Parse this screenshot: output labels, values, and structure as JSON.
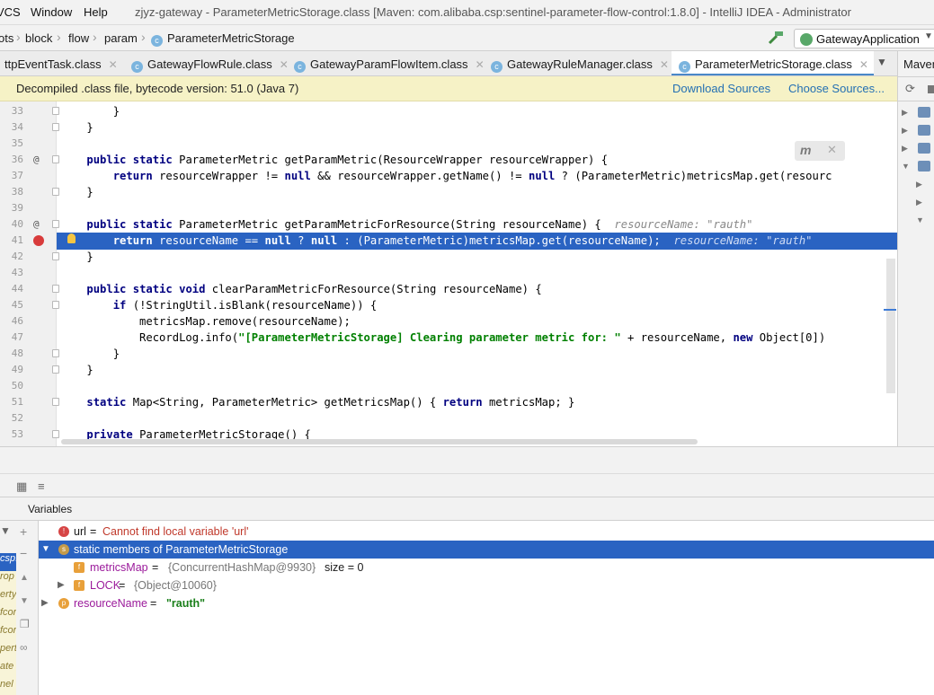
{
  "titlebar": {
    "menu": [
      "VCS",
      "Window",
      "Help"
    ],
    "title": "zjyz-gateway - ParameterMetricStorage.class [Maven: com.alibaba.csp:sentinel-parameter-flow-control:1.8.0] - IntelliJ IDEA - Administrator"
  },
  "nav": {
    "crumbs": [
      "ots",
      "block",
      "flow",
      "param",
      "ParameterMetricStorage"
    ],
    "run_config": "GatewayApplication"
  },
  "tabs": [
    {
      "label": "ttpEventTask.class",
      "active": false
    },
    {
      "label": "GatewayFlowRule.class",
      "active": false
    },
    {
      "label": "GatewayParamFlowItem.class",
      "active": false
    },
    {
      "label": "GatewayRuleManager.class",
      "active": false
    },
    {
      "label": "ParameterMetricStorage.class",
      "active": true
    }
  ],
  "maven": {
    "title": "Maven"
  },
  "banner": {
    "text": "Decompiled .class file, bytecode version: 51.0 (Java 7)",
    "download": "Download Sources",
    "choose": "Choose Sources..."
  },
  "editor": {
    "lines": [
      {
        "n": "33",
        "text": "        }"
      },
      {
        "n": "34",
        "text": "    }"
      },
      {
        "n": "35",
        "text": ""
      },
      {
        "n": "36",
        "text": "    public static ParameterMetric getParamMetric(ResourceWrapper resourceWrapper) {"
      },
      {
        "n": "37",
        "text": "        return resourceWrapper != null && resourceWrapper.getName() != null ? (ParameterMetric)metricsMap.get(resourc"
      },
      {
        "n": "38",
        "text": "    }"
      },
      {
        "n": "39",
        "text": ""
      },
      {
        "n": "40",
        "text": "    public static ParameterMetric getParamMetricForResource(String resourceName) {"
      },
      {
        "n": "41",
        "text": "        return resourceName == null ? null : (ParameterMetric)metricsMap.get(resourceName);"
      },
      {
        "n": "42",
        "text": "    }"
      },
      {
        "n": "43",
        "text": ""
      },
      {
        "n": "44",
        "text": "    public static void clearParamMetricForResource(String resourceName) {"
      },
      {
        "n": "45",
        "text": "        if (!StringUtil.isBlank(resourceName)) {"
      },
      {
        "n": "46",
        "text": "            metricsMap.remove(resourceName);"
      },
      {
        "n": "47",
        "text": "            RecordLog.info(\"[ParameterMetricStorage] Clearing parameter metric for: \" + resourceName, new Object[0])"
      },
      {
        "n": "48",
        "text": "        }"
      },
      {
        "n": "49",
        "text": "    }"
      },
      {
        "n": "50",
        "text": ""
      },
      {
        "n": "51",
        "text": "    static Map<String, ParameterMetric> getMetricsMap() { return metricsMap; }"
      },
      {
        "n": "52",
        "text": ""
      },
      {
        "n": "53",
        "text": "    private ParameterMetricStorage() {"
      }
    ],
    "hint40": "resourceName: \"rauth\"",
    "hint41": "resourceName: \"rauth\""
  },
  "debug": {
    "variables_title": "Variables",
    "vars": [
      {
        "name": "url",
        "eq": " = ",
        "value": "Cannot find local variable 'url'"
      },
      {
        "name": "static members of ParameterMetricStorage"
      },
      {
        "name": "metricsMap",
        "eq": " = ",
        "value": "{ConcurrentHashMap@9930}",
        "extra": "size = 0"
      },
      {
        "name": "LOCK",
        "eq": " = ",
        "value": "{Object@10060}"
      },
      {
        "name": "resourceName",
        "eq": " = ",
        "value": "\"rauth\""
      }
    ],
    "frames": [
      "csp.",
      "rop",
      "erty",
      "fcor",
      "fcor",
      "pert",
      "ate",
      "nel"
    ]
  },
  "colors": {
    "accent": "#2a63c2",
    "banner": "#f6f2c6",
    "link": "#2470b3"
  }
}
